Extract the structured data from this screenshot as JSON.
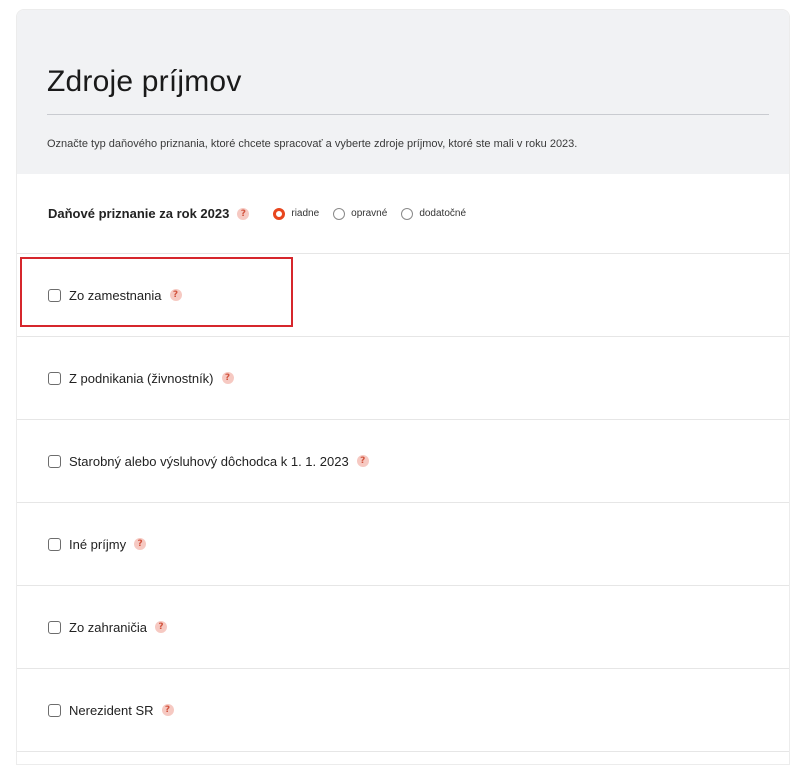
{
  "header": {
    "title": "Zdroje príjmov",
    "subtitle": "Označte typ daňového priznania, ktoré chcete spracovať a vyberte zdroje príjmov, ktoré ste mali v roku 2023."
  },
  "tax_return": {
    "label": "Daňové priznanie za rok 2023",
    "help": "?",
    "options": [
      {
        "label": "riadne",
        "selected": true
      },
      {
        "label": "opravné",
        "selected": false
      },
      {
        "label": "dodatočné",
        "selected": false
      }
    ]
  },
  "sources": [
    {
      "label": "Zo zamestnania",
      "help": "?",
      "checked": false,
      "highlighted": true
    },
    {
      "label": "Z podnikania (živnostník)",
      "help": "?",
      "checked": false
    },
    {
      "label": "Starobný alebo výsluhový dôchodca k 1. 1. 2023",
      "help": "?",
      "checked": false
    },
    {
      "label": "Iné príjmy",
      "help": "?",
      "checked": false
    },
    {
      "label": "Zo zahraničia",
      "help": "?",
      "checked": false
    },
    {
      "label": "Nerezident SR",
      "help": "?",
      "checked": false
    }
  ],
  "colors": {
    "accent": "#e8461e",
    "highlight_border": "#d6262c",
    "header_bg": "#f1f2f4",
    "help_bg": "#f6c9c2"
  }
}
